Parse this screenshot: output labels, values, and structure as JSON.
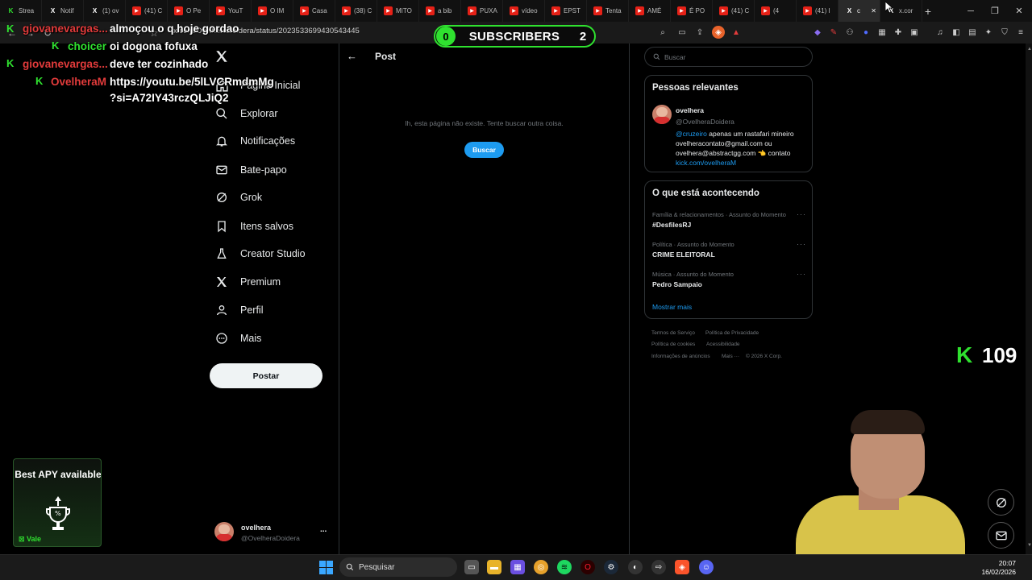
{
  "browser": {
    "tabs": [
      {
        "label": "Strea",
        "icon": "kick-icon",
        "color": "#2fe12f"
      },
      {
        "label": "Notif",
        "icon": "x-icon",
        "color": "#000000"
      },
      {
        "label": "(1) ov",
        "icon": "x-icon",
        "color": "#000000"
      },
      {
        "label": "(41) C",
        "icon": "youtube-icon",
        "color": "#e62117"
      },
      {
        "label": "O Pe",
        "icon": "youtube-icon",
        "color": "#e62117"
      },
      {
        "label": "YouT",
        "icon": "youtube-icon",
        "color": "#e62117"
      },
      {
        "label": "O IM",
        "icon": "youtube-icon",
        "color": "#e62117"
      },
      {
        "label": "Casa",
        "icon": "youtube-icon",
        "color": "#e62117"
      },
      {
        "label": "(38) C",
        "icon": "youtube-icon",
        "color": "#e62117"
      },
      {
        "label": "MITO",
        "icon": "youtube-icon",
        "color": "#e62117"
      },
      {
        "label": "a bib",
        "icon": "youtube-icon",
        "color": "#e62117"
      },
      {
        "label": "PUXA",
        "icon": "youtube-icon",
        "color": "#e62117"
      },
      {
        "label": "vídeo",
        "icon": "youtube-icon",
        "color": "#e62117"
      },
      {
        "label": "EPST",
        "icon": "youtube-icon",
        "color": "#e62117"
      },
      {
        "label": "Tenta",
        "icon": "youtube-icon",
        "color": "#e62117"
      },
      {
        "label": "AMÉ",
        "icon": "youtube-icon",
        "color": "#e62117"
      },
      {
        "label": "É PO",
        "icon": "youtube-icon",
        "color": "#e62117"
      },
      {
        "label": "(41) C",
        "icon": "youtube-icon",
        "color": "#e62117"
      },
      {
        "label": "(4",
        "icon": "youtube-icon",
        "color": "#e62117"
      },
      {
        "label": "(41) I",
        "icon": "youtube-icon",
        "color": "#e62117"
      },
      {
        "label": "c",
        "icon": "x-icon",
        "color": "#000000"
      },
      {
        "label": "x.cor",
        "icon": "x-icon",
        "color": "#000000"
      }
    ],
    "new_tab": "+",
    "url": "x.com/OvelheraDoidera/status/2023533699430543445"
  },
  "overlay": {
    "subs_left": "0",
    "subs_label": "SUBSCRIBERS",
    "subs_right": "2",
    "viewers": "109",
    "chat": [
      {
        "user": "giovanevargas...",
        "msg": "almoçou o q hoje gordao",
        "red": true
      },
      {
        "user": "choicer",
        "msg": "oi dogona fofuxa",
        "red": false
      },
      {
        "user": "giovanevargas...",
        "msg": "deve ter cozinhado",
        "red": true
      },
      {
        "user": "OvelheraM",
        "msg": "https://youtu.be/5lLVCRmdmMg",
        "red": true
      },
      {
        "user": "",
        "msg": "?si=A72IY43rczQLJiQ2",
        "red": false
      }
    ],
    "ad_title": "Best APY available",
    "ad_brand": "Vale"
  },
  "sidebar": {
    "items": [
      {
        "label": "Página Inicial",
        "icon": "home-icon"
      },
      {
        "label": "Explorar",
        "icon": "search-icon"
      },
      {
        "label": "Notificações",
        "icon": "bell-icon"
      },
      {
        "label": "Bate-papo",
        "icon": "mail-icon"
      },
      {
        "label": "Grok",
        "icon": "grok-icon"
      },
      {
        "label": "Itens salvos",
        "icon": "bookmark-icon"
      },
      {
        "label": "Creator Studio",
        "icon": "flask-icon"
      },
      {
        "label": "Premium",
        "icon": "x-icon"
      },
      {
        "label": "Perfil",
        "icon": "person-icon"
      },
      {
        "label": "Mais",
        "icon": "more-circle-icon"
      }
    ],
    "post_button": "Postar",
    "account_name": "ovelhera",
    "account_handle": "@OvelheraDoidera",
    "account_more": "..."
  },
  "main": {
    "title": "Post",
    "error": "Ih, esta página não existe. Tente buscar outra coisa.",
    "search_button": "Buscar"
  },
  "right": {
    "search_placeholder": "Buscar",
    "relevant_title": "Pessoas relevantes",
    "person_name": "ovelhera",
    "person_handle": "@OvelheraDoidera",
    "bio_mention": "@cruzeiro",
    "bio_line1": "apenas um rastafari mineiro",
    "bio_line2": "ovelheracontato@gmail.com ou",
    "bio_line3": "ovelhera@abstractgg.com 👈 contato",
    "bio_link": "kick.com/ovelheraM",
    "trends_title": "O que está acontecendo",
    "trends": [
      {
        "category": "Família & relacionamentos · Assunto do Momento",
        "name": "#DesfilesRJ"
      },
      {
        "category": "Política · Assunto do Momento",
        "name": "CRIME ELEITORAL"
      },
      {
        "category": "Música · Assunto do Momento",
        "name": "Pedro Sampaio"
      }
    ],
    "show_more": "Mostrar mais",
    "footer": [
      "Termos de Serviço",
      "Política de Privacidade",
      "Política de cookies",
      "Acessibilidade",
      "Informações de anúncios",
      "Mais ···",
      "© 2026 X Corp."
    ]
  },
  "taskbar": {
    "search_placeholder": "Pesquisar",
    "time": "20:07",
    "date": "16/02/2026"
  },
  "colors": {
    "accent": "#1d9bf0",
    "kick_green": "#2fe12f",
    "chat_red": "#e23b3b"
  }
}
